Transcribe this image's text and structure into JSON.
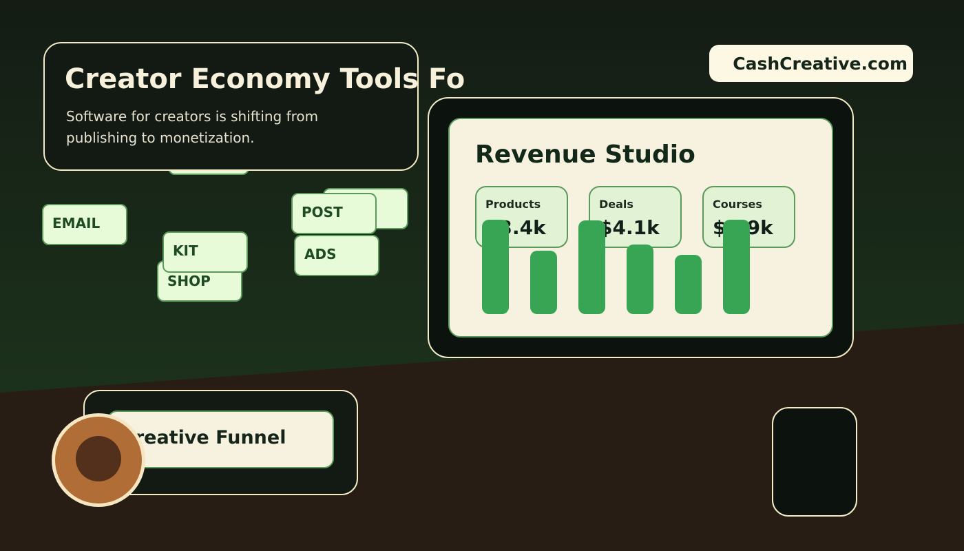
{
  "headline": "Creator Economy Tools Fo",
  "subtitle": "Software for creators is shifting from publishing to monetization.",
  "brand": "CashCreative.com",
  "chips": [
    "EMAIL",
    "POST",
    "KIT",
    "ADS",
    "SHOP"
  ],
  "studio": {
    "title": "Revenue Studio",
    "stats": [
      {
        "label": "Products",
        "value": "$3.4k"
      },
      {
        "label": "Deals",
        "value": "$4.1k"
      },
      {
        "label": "Courses",
        "value": "$2.9k"
      }
    ],
    "bars": [
      1.0,
      0.67,
      0.99,
      0.74,
      0.63,
      1.0
    ]
  },
  "funnel": {
    "title": "Creative Funnel"
  },
  "colors": {
    "accent": "#37a554",
    "chip_bg": "#e7fbd8",
    "panel": "#f7f1df",
    "coin": "#b06e36"
  }
}
